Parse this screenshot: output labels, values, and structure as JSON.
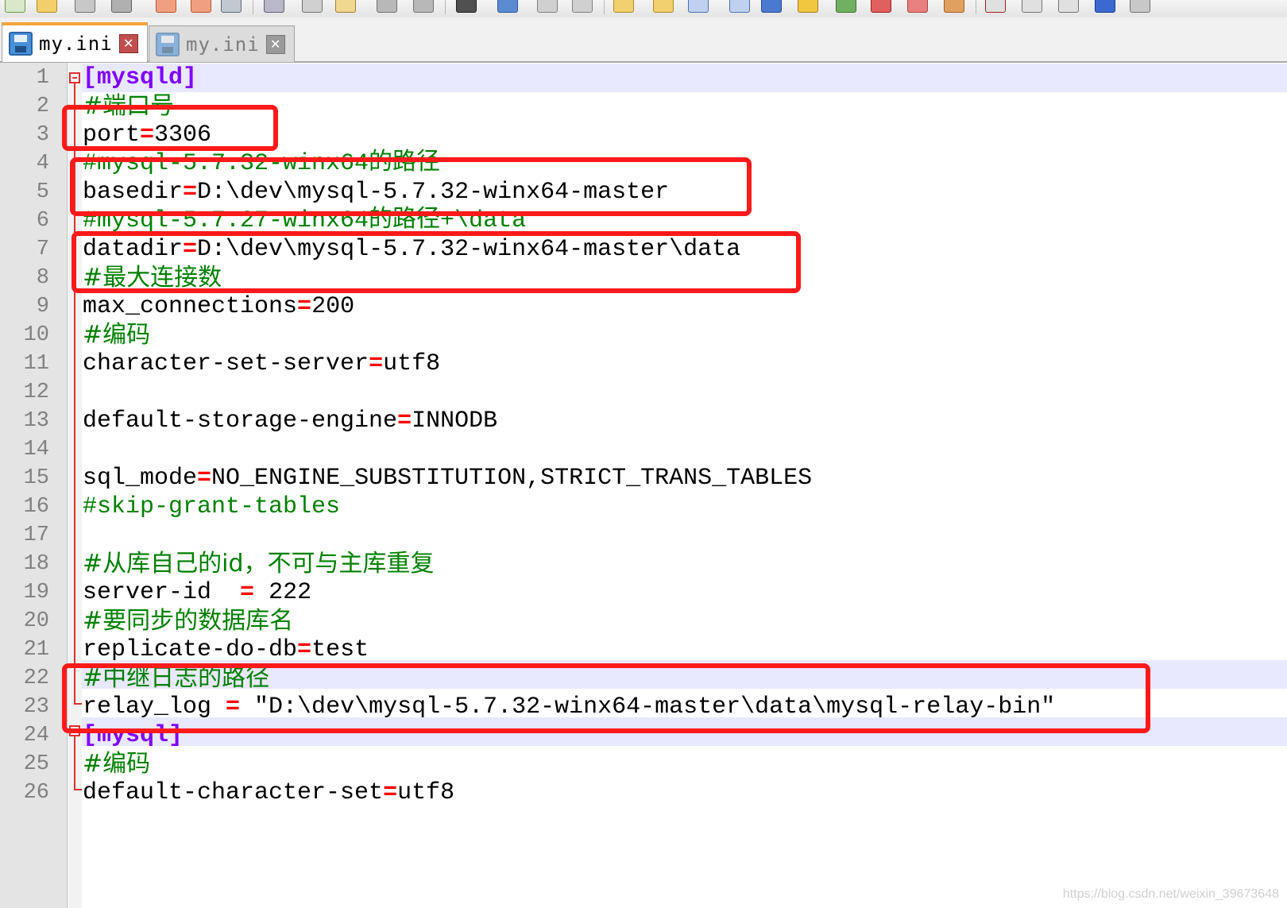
{
  "tabs": [
    {
      "label": "my.ini",
      "close": "✕"
    },
    {
      "label": "my.ini",
      "close": "✕"
    }
  ],
  "line_numbers": [
    "1",
    "2",
    "3",
    "4",
    "5",
    "6",
    "7",
    "8",
    "9",
    "10",
    "11",
    "12",
    "13",
    "14",
    "15",
    "16",
    "17",
    "18",
    "19",
    "20",
    "21",
    "22",
    "23",
    "24",
    "25",
    "26"
  ],
  "code": {
    "l1": "[mysqld]",
    "l2": "#端口号",
    "l3_key": "port",
    "l3_op": "=",
    "l3_val": "3306",
    "l4": "#mysql-5.7.32-winx64的路径",
    "l5_key": "basedir",
    "l5_op": "=",
    "l5_val": "D:\\dev\\mysql-5.7.32-winx64-master",
    "l6": "#mysql-5.7.27-winx64的路径+\\data",
    "l7_key": "datadir",
    "l7_op": "=",
    "l7_val": "D:\\dev\\mysql-5.7.32-winx64-master\\data",
    "l8": "#最大连接数",
    "l9_key": "max_connections",
    "l9_op": "=",
    "l9_val": "200",
    "l10": "#编码",
    "l11_key": "character-set-server",
    "l11_op": "=",
    "l11_val": "utf8",
    "l13_key": "default-storage-engine",
    "l13_op": "=",
    "l13_val": "INNODB",
    "l15_key": "sql_mode",
    "l15_op": "=",
    "l15_val": "NO_ENGINE_SUBSTITUTION,STRICT_TRANS_TABLES",
    "l16": "#skip-grant-tables",
    "l18": "#从库自己的id，不可与主库重复",
    "l19_key": "server-id  ",
    "l19_op": "=",
    "l19_val": " 222",
    "l20": "#要同步的数据库名",
    "l21_key": "replicate-do-db",
    "l21_op": "=",
    "l21_val": "test",
    "l22": "#中继日志的路径",
    "l23_key": "relay_log ",
    "l23_op": "=",
    "l23_val": " \"D:\\dev\\mysql-5.7.32-winx64-master\\data\\mysql-relay-bin\"",
    "l24": "[mysql]",
    "l25": "#编码",
    "l26_key": "default-character-set",
    "l26_op": "=",
    "l26_val": "utf8"
  },
  "colors": {
    "section": "#8000ff",
    "comment": "#008000",
    "operator": "#ff0000",
    "annotation_box": "#ff1a1a",
    "current_line": "#e8e8ff",
    "active_tab_accent": "#f3a33a"
  },
  "watermark": "https://blog.csdn.net/weixin_39673648"
}
